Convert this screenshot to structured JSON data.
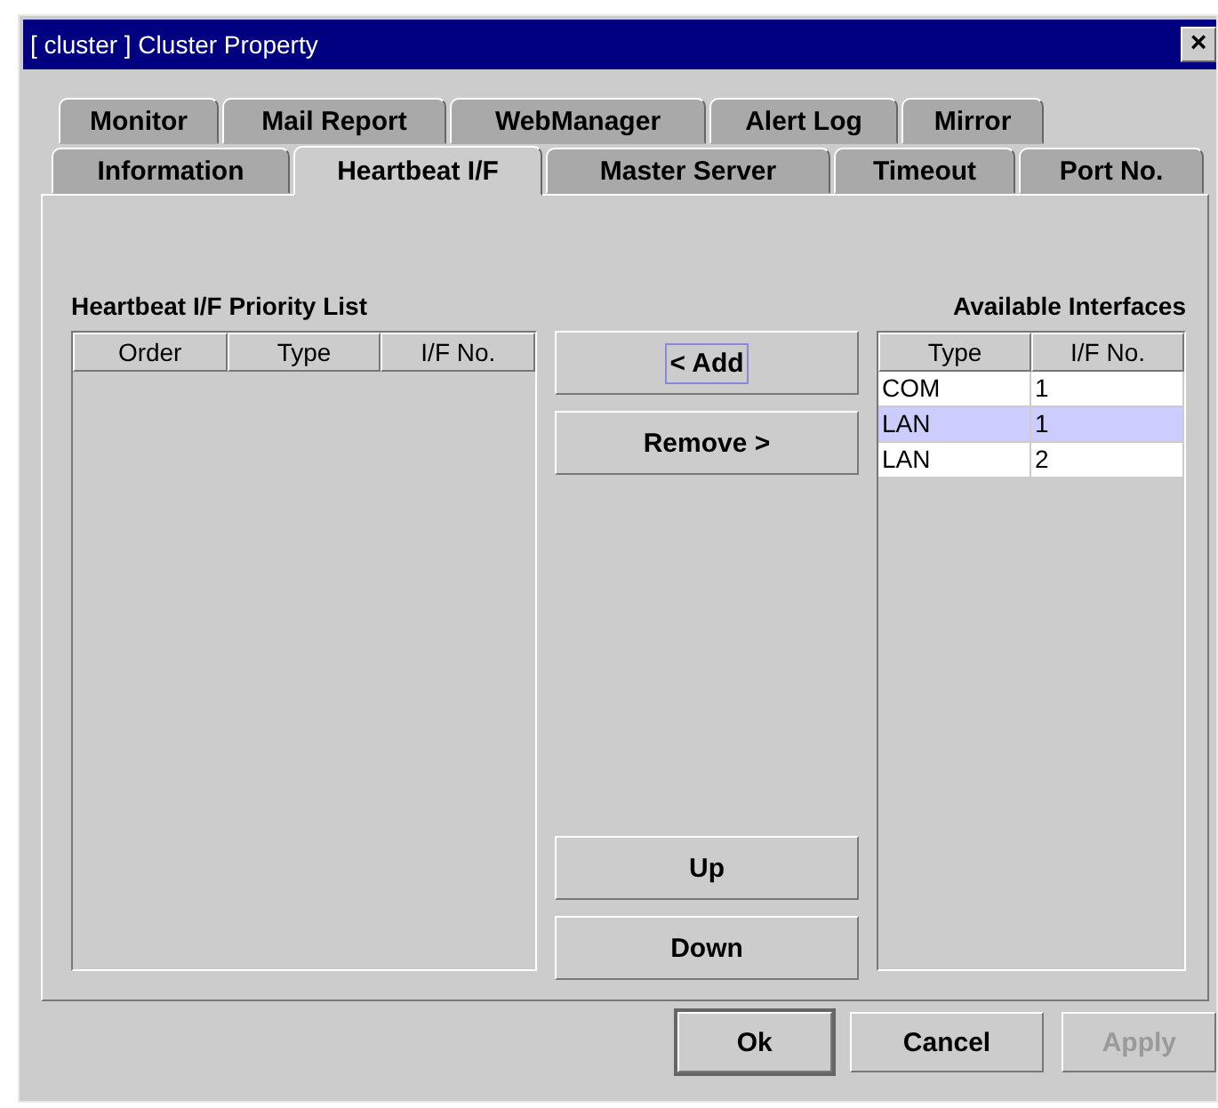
{
  "window": {
    "title": "[ cluster ] Cluster Property",
    "close": "×"
  },
  "tab_rows": [
    {
      "tabs": [
        {
          "label": "Monitor",
          "selected": false
        },
        {
          "label": "Mail Report",
          "selected": false
        },
        {
          "label": "WebManager",
          "selected": false
        },
        {
          "label": "Alert Log",
          "selected": false
        },
        {
          "label": "Mirror",
          "selected": false
        }
      ]
    },
    {
      "tabs": [
        {
          "label": "Information",
          "selected": false
        },
        {
          "label": "Heartbeat I/F",
          "selected": true
        },
        {
          "label": "Master Server",
          "selected": false
        },
        {
          "label": "Timeout",
          "selected": false
        },
        {
          "label": "Port No.",
          "selected": false
        }
      ]
    }
  ],
  "priority_list": {
    "label": "Heartbeat I/F Priority List",
    "columns": [
      "Order",
      "Type",
      "I/F No."
    ]
  },
  "buttons": [
    {
      "label": "< Add",
      "focused": true
    },
    {
      "label": "Remove >",
      "focused": false
    },
    {
      "label": "Up",
      "focused": false
    },
    {
      "label": "Down",
      "focused": false
    }
  ],
  "available": {
    "label": "Available Interfaces",
    "columns": [
      "Type",
      "I/F No."
    ],
    "rows": [
      {
        "cells": [
          "COM",
          "1"
        ],
        "selected": false
      },
      {
        "cells": [
          "LAN",
          "1"
        ],
        "selected": true
      },
      {
        "cells": [
          "LAN",
          "2"
        ],
        "selected": false
      }
    ]
  },
  "footer": [
    {
      "label": "Ok",
      "default": true,
      "disabled": false
    },
    {
      "label": "Cancel",
      "default": false,
      "disabled": false
    },
    {
      "label": "Apply",
      "default": false,
      "disabled": true
    }
  ]
}
